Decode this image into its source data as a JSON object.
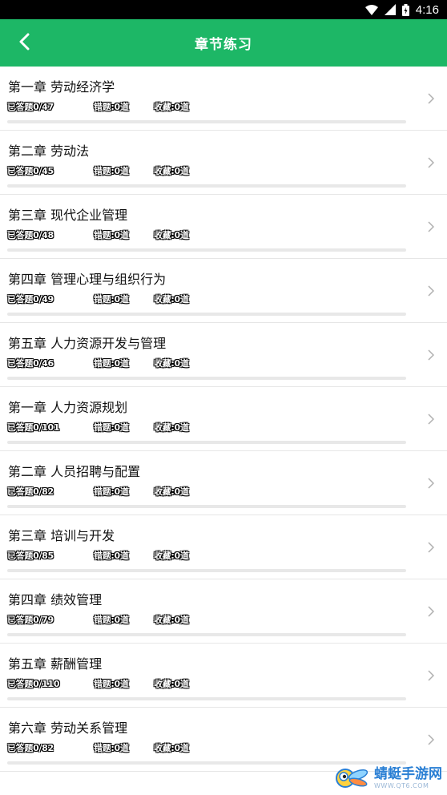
{
  "status_bar": {
    "time": "4:16"
  },
  "header": {
    "title": "章节练习",
    "back_icon": "chevron-left-icon"
  },
  "colors": {
    "accent": "#1db766",
    "status_bar": "#000000",
    "divider": "#e6e6e6"
  },
  "chapters": [
    {
      "name": "第一章 劳动经济学",
      "answered": "已答题0/47",
      "wrong": "错题:0道",
      "favorites": "收藏:0道",
      "progress": 0
    },
    {
      "name": "第二章 劳动法",
      "answered": "已答题0/45",
      "wrong": "错题:0道",
      "favorites": "收藏:0道",
      "progress": 0
    },
    {
      "name": "第三章 现代企业管理",
      "answered": "已答题0/48",
      "wrong": "错题:0道",
      "favorites": "收藏:0道",
      "progress": 0
    },
    {
      "name": "第四章 管理心理与组织行为",
      "answered": "已答题0/49",
      "wrong": "错题:0道",
      "favorites": "收藏:0道",
      "progress": 0
    },
    {
      "name": "第五章 人力资源开发与管理",
      "answered": "已答题0/46",
      "wrong": "错题:0道",
      "favorites": "收藏:0道",
      "progress": 0
    },
    {
      "name": "第一章 人力资源规划",
      "answered": "已答题0/101",
      "wrong": "错题:0道",
      "favorites": "收藏:0道",
      "progress": 0
    },
    {
      "name": "第二章 人员招聘与配置",
      "answered": "已答题0/82",
      "wrong": "错题:0道",
      "favorites": "收藏:0道",
      "progress": 0
    },
    {
      "name": "第三章 培训与开发",
      "answered": "已答题0/85",
      "wrong": "错题:0道",
      "favorites": "收藏:0道",
      "progress": 0
    },
    {
      "name": "第四章 绩效管理",
      "answered": "已答题0/79",
      "wrong": "错题:0道",
      "favorites": "收藏:0道",
      "progress": 0
    },
    {
      "name": "第五章 薪酬管理",
      "answered": "已答题0/110",
      "wrong": "错题:0道",
      "favorites": "收藏:0道",
      "progress": 0
    },
    {
      "name": "第六章 劳动关系管理",
      "answered": "已答题0/82",
      "wrong": "错题:0道",
      "favorites": "收藏:0道",
      "progress": 0
    }
  ],
  "watermark": {
    "name": "蜻蜓手游网",
    "url": "WWW.QT6.COM"
  }
}
